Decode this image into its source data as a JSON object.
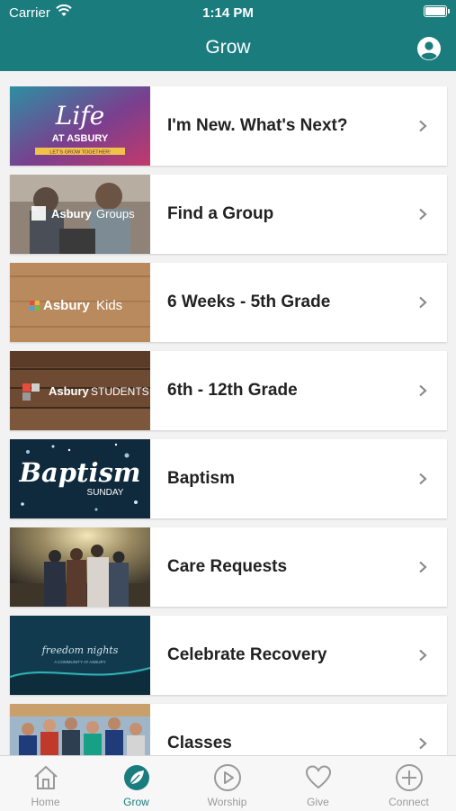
{
  "status_bar": {
    "carrier": "Carrier",
    "time": "1:14 PM"
  },
  "nav": {
    "title": "Grow"
  },
  "thumbs": {
    "life": {
      "script": "Life",
      "line": "AT ASBURY",
      "ribbon": "LET'S GROW TOGETHER!"
    },
    "groups": {
      "brand": "Asbury",
      "sub": "Groups"
    },
    "kids": {
      "brand": "Asbury",
      "sub": "Kids"
    },
    "students": {
      "brand": "Asbury",
      "sub": "STUDENTS"
    },
    "baptism": {
      "script": "Baptism",
      "sub": "SUNDAY"
    },
    "recovery": {
      "script": "freedom nights",
      "sub": "A COMMUNITY AT ASBURY"
    }
  },
  "items": [
    {
      "label": "I'm New. What's Next?"
    },
    {
      "label": "Find a Group"
    },
    {
      "label": "6 Weeks - 5th Grade"
    },
    {
      "label": "6th - 12th Grade"
    },
    {
      "label": "Baptism"
    },
    {
      "label": "Care Requests"
    },
    {
      "label": "Celebrate Recovery"
    },
    {
      "label": "Classes"
    }
  ],
  "tabs": [
    {
      "label": "Home",
      "icon": "home-icon"
    },
    {
      "label": "Grow",
      "icon": "leaf-icon",
      "active": true
    },
    {
      "label": "Worship",
      "icon": "play-icon"
    },
    {
      "label": "Give",
      "icon": "heart-icon"
    },
    {
      "label": "Connect",
      "icon": "plus-icon"
    }
  ],
  "colors": {
    "accent": "#1b7c7e",
    "tab_inactive": "#9a9a9a"
  }
}
